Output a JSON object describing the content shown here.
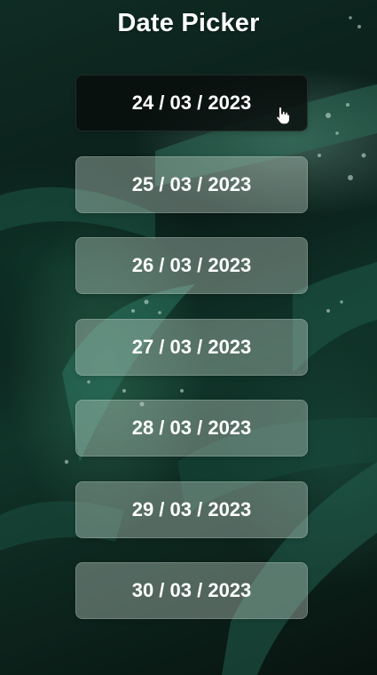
{
  "app": {
    "title": "Date Picker"
  },
  "dates": [
    {
      "label": "24 / 03 / 2023",
      "active": true
    },
    {
      "label": "25 / 03 / 2023",
      "active": false
    },
    {
      "label": "26 / 03 / 2023",
      "active": false
    },
    {
      "label": "27 / 03 / 2023",
      "active": false
    },
    {
      "label": "28 / 03 / 2023",
      "active": false
    },
    {
      "label": "29 / 03 / 2023",
      "active": false
    },
    {
      "label": "30 / 03 / 2023",
      "active": false
    }
  ],
  "icons": {
    "pointer": "hand-pointer-icon"
  },
  "colors": {
    "text": "#ffffff",
    "active_button": "#0b0f0d",
    "background": "#0b1713"
  }
}
